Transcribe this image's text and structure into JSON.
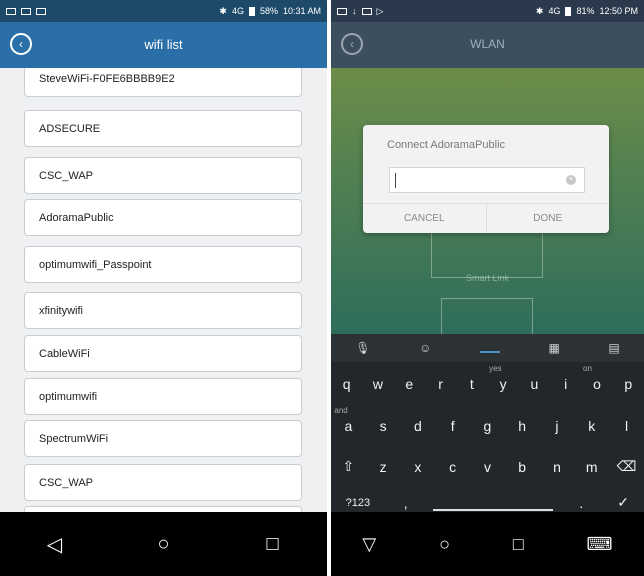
{
  "left": {
    "status": {
      "battery": "58%",
      "time": "10:31 AM",
      "network": "4G"
    },
    "header": {
      "title": "wifi list"
    },
    "networks": [
      "SteveWiFi-F0FE6BBBB9E2",
      "ADSECURE",
      "CSC_WAP",
      "AdoramaPublic",
      "optimumwifi_Passpoint",
      "xfinitywifi",
      "CableWiFi",
      "optimumwifi",
      "SpectrumWiFi",
      "CSC_WAP",
      ""
    ],
    "nav": {
      "back": "◁",
      "home": "○",
      "recents": "□"
    }
  },
  "right": {
    "status": {
      "battery": "81%",
      "time": "12:50 PM",
      "network": "4G"
    },
    "header": {
      "title": "WLAN"
    },
    "background_label": "Smart Link",
    "dialog": {
      "title": "Connect  AdoramaPublic",
      "input_value": "",
      "cancel": "CANCEL",
      "done": "DONE"
    },
    "keyboard": {
      "suggestions": [
        "🎙",
        "☺",
        "",
        "▦",
        "📋"
      ],
      "row1": [
        "q",
        "w",
        "e",
        "r",
        "t",
        "y",
        "u",
        "i",
        "o",
        "p"
      ],
      "row1_hints": {
        "q": "",
        "t": "yes",
        "o": "on"
      },
      "row2": [
        "a",
        "s",
        "d",
        "f",
        "g",
        "h",
        "j",
        "k",
        "l"
      ],
      "row2_hint": "and",
      "row3": [
        "⇧",
        "z",
        "x",
        "c",
        "v",
        "b",
        "n",
        "m",
        "⌫"
      ],
      "row4": {
        "symbols": "?123",
        "comma": ",",
        "period": ".",
        "enter": "✓"
      }
    },
    "nav": {
      "back": "▽",
      "home": "○",
      "recents": "□",
      "keyboard": "⌨"
    }
  },
  "colors": {
    "left_header": "#2a6fa8",
    "left_status": "#1e4a6a",
    "right_header": "#3d4f5f",
    "keyboard": "#23272b"
  }
}
